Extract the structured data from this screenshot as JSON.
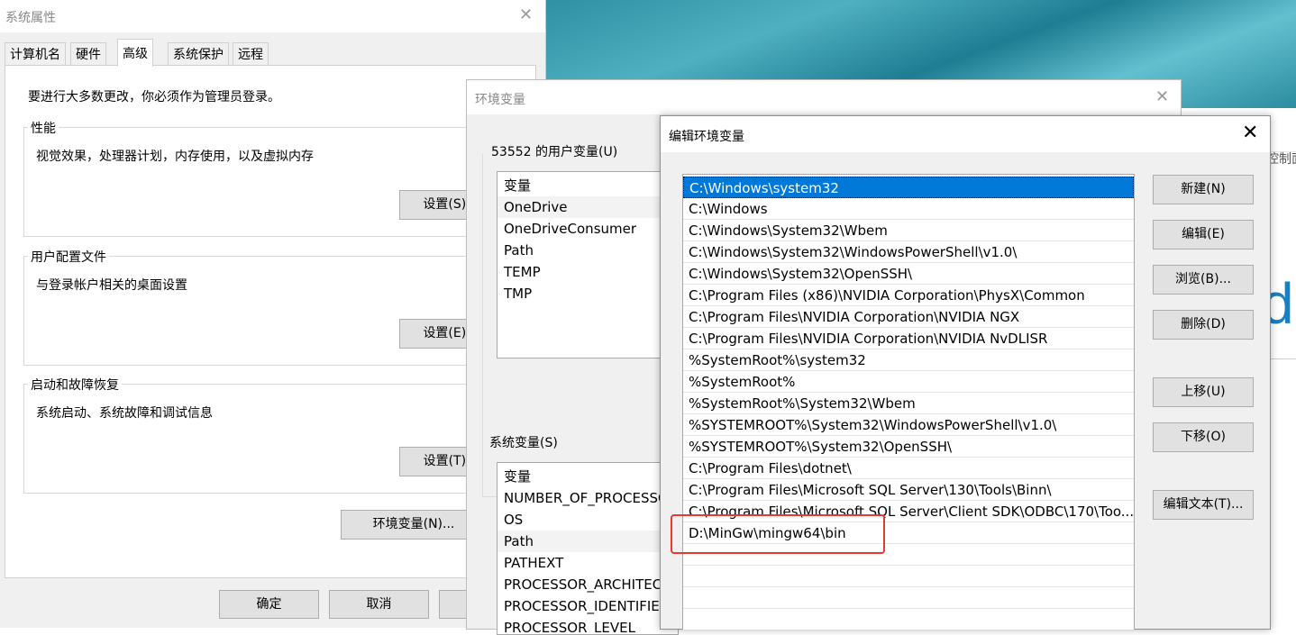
{
  "desktop": {
    "right_text": "控制面",
    "big_letter": "d"
  },
  "sysprops": {
    "title": "系统属性",
    "tabs": [
      "计算机名",
      "硬件",
      "高级",
      "系统保护",
      "远程"
    ],
    "admin_note": "要进行大多数更改，你必须作为管理员登录。",
    "performance": {
      "label": "性能",
      "desc": "视觉效果，处理器计划，内存使用，以及虚拟内存",
      "button": "设置(S)..."
    },
    "user_profiles": {
      "label": "用户配置文件",
      "desc": "与登录帐户相关的桌面设置",
      "button": "设置(E)..."
    },
    "startup": {
      "label": "启动和故障恢复",
      "desc": "系统启动、系统故障和调试信息",
      "button": "设置(T)..."
    },
    "env_button": "环境变量(N)...",
    "ok": "确定",
    "cancel": "取消"
  },
  "envvars": {
    "title": "环境变量",
    "user_section": "53552 的用户变量(U)",
    "user_header": "变量",
    "user_vars": [
      "OneDrive",
      "OneDriveConsumer",
      "Path",
      "TEMP",
      "TMP"
    ],
    "system_section": "系统变量(S)",
    "system_header": "变量",
    "system_vars": [
      "NUMBER_OF_PROCESSORS",
      "OS",
      "Path",
      "PATHEXT",
      "PROCESSOR_ARCHITECTURE",
      "PROCESSOR_IDENTIFIER",
      "PROCESSOR_LEVEL"
    ]
  },
  "editenv": {
    "title": "编辑环境变量",
    "paths": [
      "C:\\Windows\\system32",
      "C:\\Windows",
      "C:\\Windows\\System32\\Wbem",
      "C:\\Windows\\System32\\WindowsPowerShell\\v1.0\\",
      "C:\\Windows\\System32\\OpenSSH\\",
      "C:\\Program Files (x86)\\NVIDIA Corporation\\PhysX\\Common",
      "C:\\Program Files\\NVIDIA Corporation\\NVIDIA NGX",
      "C:\\Program Files\\NVIDIA Corporation\\NVIDIA NvDLISR",
      "%SystemRoot%\\system32",
      "%SystemRoot%",
      "%SystemRoot%\\System32\\Wbem",
      "%SYSTEMROOT%\\System32\\WindowsPowerShell\\v1.0\\",
      "%SYSTEMROOT%\\System32\\OpenSSH\\",
      "C:\\Program Files\\dotnet\\",
      "C:\\Program Files\\Microsoft SQL Server\\130\\Tools\\Binn\\",
      "C:\\Program Files\\Microsoft SQL Server\\Client SDK\\ODBC\\170\\Too...",
      "D:\\MinGw\\mingw64\\bin"
    ],
    "buttons": {
      "new": "新建(N)",
      "edit": "编辑(E)",
      "browse": "浏览(B)...",
      "delete": "删除(D)",
      "up": "上移(U)",
      "down": "下移(O)",
      "edit_text": "编辑文本(T)..."
    },
    "accent": "#0078d7",
    "highlight_color": "#e53935"
  }
}
